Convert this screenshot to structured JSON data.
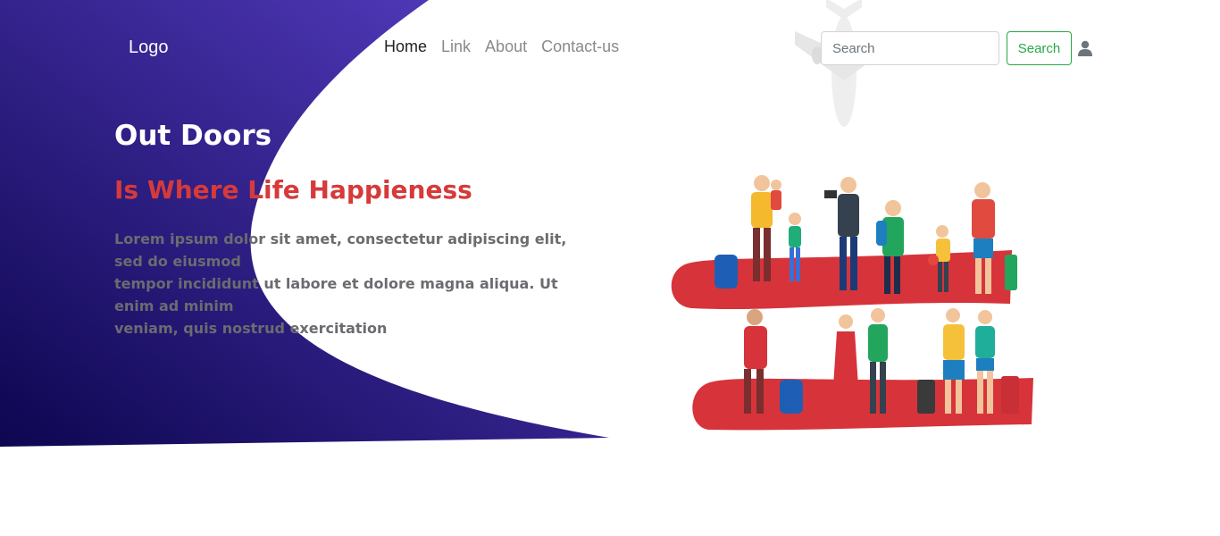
{
  "navbar": {
    "logo": "Logo",
    "links": [
      {
        "label": "Home",
        "active": true
      },
      {
        "label": "Link",
        "active": false
      },
      {
        "label": "About",
        "active": false
      },
      {
        "label": "Contact-us",
        "active": false
      }
    ],
    "search": {
      "placeholder": "Search",
      "button_label": "Search"
    },
    "user_icon": "user-icon"
  },
  "hero": {
    "title": "Out Doors",
    "subtitle": "Is Where Life Happieness",
    "paragraph_lines": [
      "Lorem ipsum dolor sit amet, consectetur adipiscing elit, sed do eiusmod",
      "tempor incididunt ut labore et dolore magna aliqua. Ut enim ad minim",
      "veniam, quis nostrud exercitation"
    ]
  },
  "colors": {
    "gradient_dark": "#120a5c",
    "gradient_light": "#5a40c8",
    "accent_red": "#d63a3a",
    "search_green": "#28a745"
  },
  "icons": [
    "airplane-icon",
    "user-icon"
  ]
}
